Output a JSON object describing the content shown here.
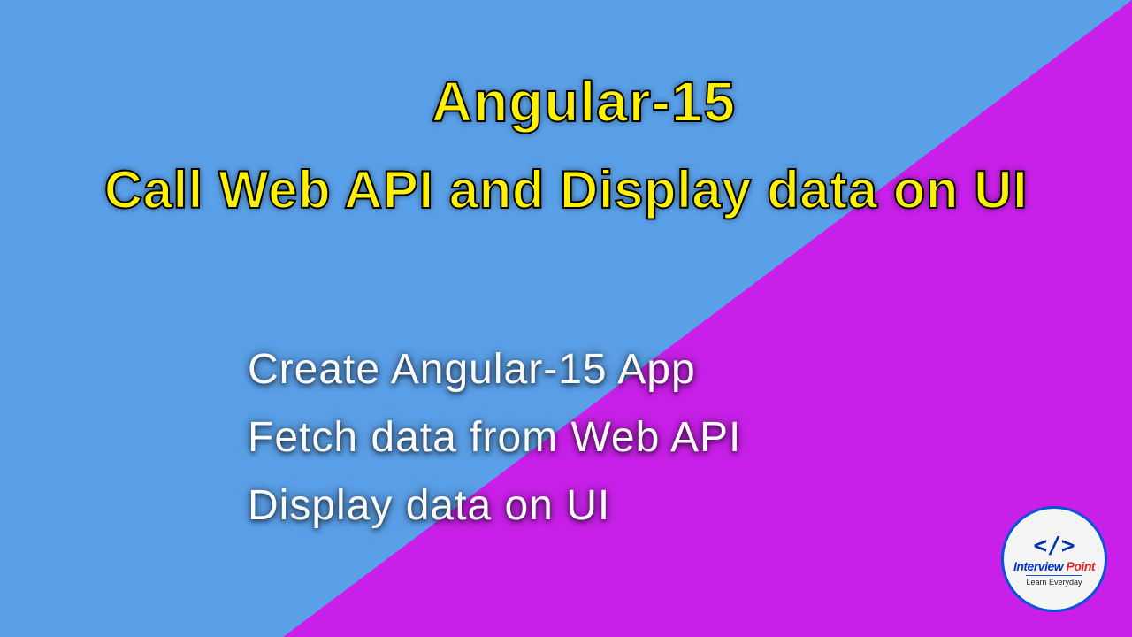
{
  "header": {
    "title_small": "Angular-15",
    "title_large": "Call Web API and Display data on UI"
  },
  "bullets": [
    "Create Angular-15 App",
    "Fetch data from Web API",
    "Display data on UI"
  ],
  "logo": {
    "icon": "</>",
    "brand_part1": "Interview",
    "brand_part2": "Point",
    "tagline": "Learn Everyday"
  },
  "colors": {
    "bg_left": "#5aa0e8",
    "bg_right": "#c820e8",
    "title_color": "#fff200",
    "bullet_color": "#fafafa"
  }
}
